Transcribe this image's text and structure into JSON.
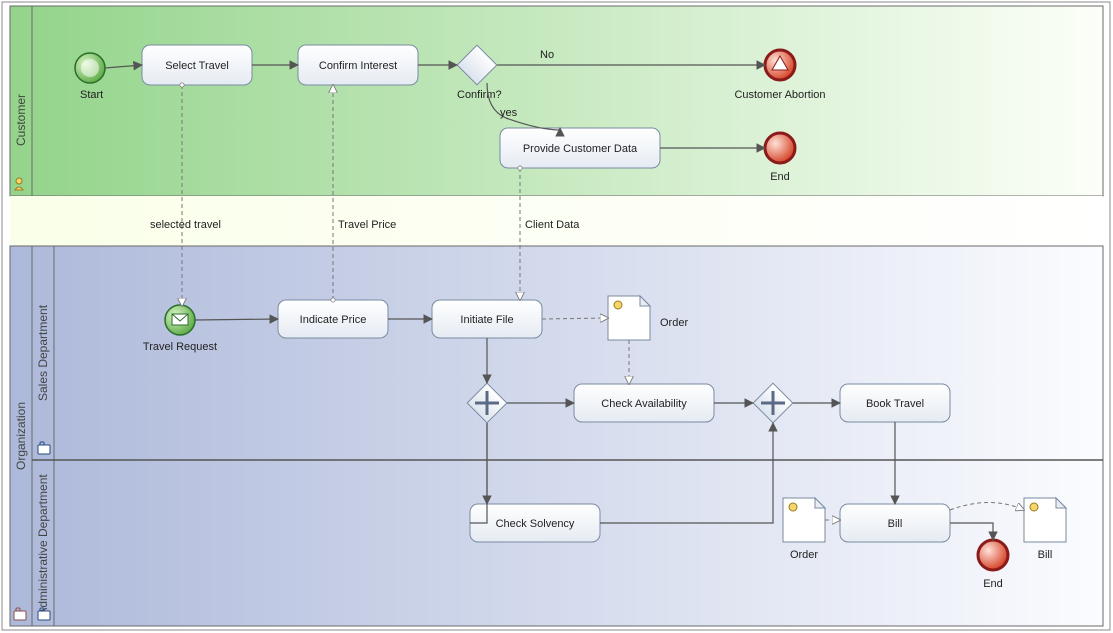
{
  "pools": {
    "customer": {
      "label": "Customer"
    },
    "organization": {
      "label": "Organization"
    }
  },
  "lanes": {
    "sales": {
      "label": "Sales Department"
    },
    "admin": {
      "label": "Administrative Department"
    }
  },
  "events": {
    "start": {
      "label": "Start"
    },
    "abort": {
      "label": "Customer Abortion"
    },
    "end_customer": {
      "label": "End"
    },
    "travel_request": {
      "label": "Travel Request"
    },
    "end_admin": {
      "label": "End"
    }
  },
  "tasks": {
    "select_travel": "Select Travel",
    "confirm_interest": "Confirm Interest",
    "provide_customer_data": "Provide Customer Data",
    "indicate_price": "Indicate Price",
    "initiate_file": "Initiate File",
    "check_availability": "Check Availability",
    "book_travel": "Book Travel",
    "check_solvency": "Check Solvency",
    "bill": "Bill"
  },
  "gateways": {
    "confirm": {
      "label": "Confirm?"
    }
  },
  "edges": {
    "no": "No",
    "yes": "yes"
  },
  "messages": {
    "selected_travel": "selected travel",
    "travel_price": "Travel Price",
    "client_data": "Client Data"
  },
  "dataObjects": {
    "order1": "Order",
    "order2": "Order",
    "bill": "Bill"
  },
  "chart_data": {
    "type": "bpmn",
    "pools": [
      {
        "id": "customer",
        "name": "Customer",
        "lanes": [
          {
            "id": "customer_lane",
            "name": "Customer"
          }
        ]
      },
      {
        "id": "organization",
        "name": "Organization",
        "lanes": [
          {
            "id": "sales",
            "name": "Sales Department"
          },
          {
            "id": "admin",
            "name": "Administrative Department"
          }
        ]
      }
    ],
    "nodes": [
      {
        "id": "start",
        "type": "startEvent",
        "lane": "customer_lane",
        "label": "Start"
      },
      {
        "id": "select_travel",
        "type": "task",
        "lane": "customer_lane",
        "label": "Select Travel"
      },
      {
        "id": "confirm_interest",
        "type": "task",
        "lane": "customer_lane",
        "label": "Confirm Interest"
      },
      {
        "id": "gw_confirm",
        "type": "exclusiveGateway",
        "lane": "customer_lane",
        "label": "Confirm?"
      },
      {
        "id": "abort",
        "type": "endEvent",
        "subtype": "terminate",
        "lane": "customer_lane",
        "label": "Customer Abortion"
      },
      {
        "id": "provide_customer_data",
        "type": "task",
        "lane": "customer_lane",
        "label": "Provide Customer Data"
      },
      {
        "id": "end_customer",
        "type": "endEvent",
        "lane": "customer_lane",
        "label": "End"
      },
      {
        "id": "travel_request",
        "type": "startEvent",
        "subtype": "message",
        "lane": "sales",
        "label": "Travel Request"
      },
      {
        "id": "indicate_price",
        "type": "task",
        "lane": "sales",
        "label": "Indicate Price"
      },
      {
        "id": "initiate_file",
        "type": "task",
        "lane": "sales",
        "label": "Initiate File"
      },
      {
        "id": "order1",
        "type": "dataObject",
        "lane": "sales",
        "label": "Order"
      },
      {
        "id": "gw_split",
        "type": "parallelGateway",
        "lane": "sales"
      },
      {
        "id": "check_availability",
        "type": "task",
        "lane": "sales",
        "label": "Check Availability"
      },
      {
        "id": "gw_join",
        "type": "parallelGateway",
        "lane": "sales"
      },
      {
        "id": "book_travel",
        "type": "task",
        "lane": "sales",
        "label": "Book Travel"
      },
      {
        "id": "check_solvency",
        "type": "task",
        "lane": "admin",
        "label": "Check Solvency"
      },
      {
        "id": "order2",
        "type": "dataObject",
        "lane": "admin",
        "label": "Order"
      },
      {
        "id": "bill_task",
        "type": "task",
        "lane": "admin",
        "label": "Bill"
      },
      {
        "id": "bill_doc",
        "type": "dataObject",
        "lane": "admin",
        "label": "Bill"
      },
      {
        "id": "end_admin",
        "type": "endEvent",
        "lane": "admin",
        "label": "End"
      }
    ],
    "sequenceFlows": [
      {
        "from": "start",
        "to": "select_travel"
      },
      {
        "from": "select_travel",
        "to": "confirm_interest"
      },
      {
        "from": "confirm_interest",
        "to": "gw_confirm"
      },
      {
        "from": "gw_confirm",
        "to": "abort",
        "label": "No"
      },
      {
        "from": "gw_confirm",
        "to": "provide_customer_data",
        "label": "yes"
      },
      {
        "from": "provide_customer_data",
        "to": "end_customer"
      },
      {
        "from": "travel_request",
        "to": "indicate_price"
      },
      {
        "from": "indicate_price",
        "to": "initiate_file"
      },
      {
        "from": "initiate_file",
        "to": "gw_split"
      },
      {
        "from": "gw_split",
        "to": "check_availability"
      },
      {
        "from": "gw_split",
        "to": "check_solvency"
      },
      {
        "from": "check_availability",
        "to": "gw_join"
      },
      {
        "from": "check_solvency",
        "to": "gw_join"
      },
      {
        "from": "gw_join",
        "to": "book_travel"
      },
      {
        "from": "book_travel",
        "to": "bill_task"
      },
      {
        "from": "bill_task",
        "to": "end_admin"
      }
    ],
    "messageFlows": [
      {
        "from": "select_travel",
        "to": "travel_request",
        "label": "selected travel"
      },
      {
        "from": "indicate_price",
        "to": "confirm_interest",
        "label": "Travel Price"
      },
      {
        "from": "provide_customer_data",
        "to": "initiate_file",
        "label": "Client Data"
      }
    ],
    "dataAssociations": [
      {
        "from": "initiate_file",
        "to": "order1"
      },
      {
        "from": "order1",
        "to": "check_availability"
      },
      {
        "from": "order2",
        "to": "bill_task"
      },
      {
        "from": "bill_task",
        "to": "bill_doc"
      }
    ]
  }
}
